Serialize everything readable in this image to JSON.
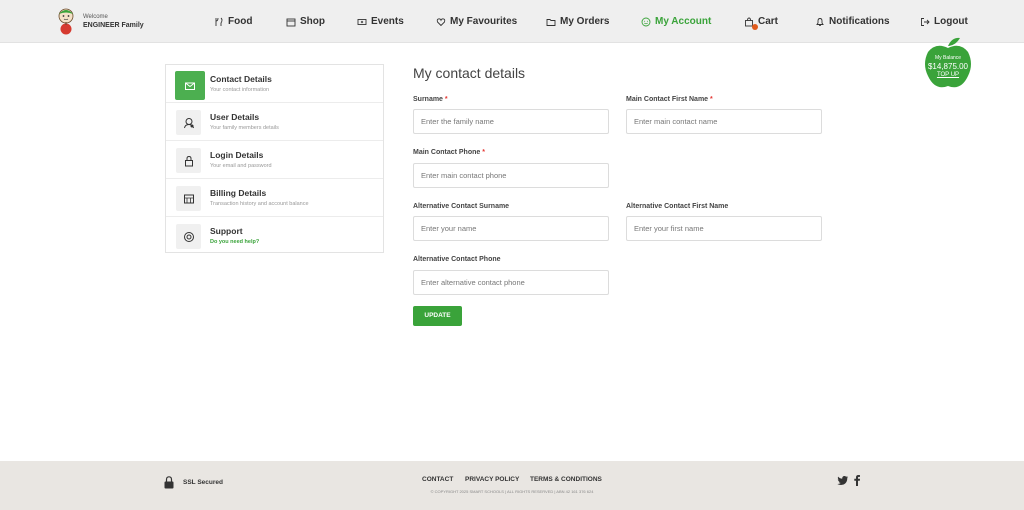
{
  "brand": {
    "welcome": "Welcome",
    "family": "ENGINEER Family"
  },
  "nav": [
    {
      "label": "Food",
      "icon": "food-icon"
    },
    {
      "label": "Shop",
      "icon": "shop-icon"
    },
    {
      "label": "Events",
      "icon": "ticket-icon"
    },
    {
      "label": "My Favourites",
      "icon": "heart-icon"
    },
    {
      "label": "My Orders",
      "icon": "folder-icon"
    },
    {
      "label": "My Account",
      "icon": "smiley-icon",
      "active": true
    },
    {
      "label": "Cart",
      "icon": "cart-bag-icon"
    },
    {
      "label": "Notifications",
      "icon": "bell-icon"
    },
    {
      "label": "Logout",
      "icon": "logout-icon"
    }
  ],
  "balance": {
    "label": "My Balance",
    "amount": "$14,875.00",
    "topup": "TOP UP"
  },
  "sidebar": [
    {
      "label": "Contact Details",
      "sub": "Your contact information",
      "icon": "mail-icon",
      "active": true
    },
    {
      "label": "User Details",
      "sub": "Your family members details",
      "icon": "users-icon"
    },
    {
      "label": "Login Details",
      "sub": "Your email and password",
      "icon": "lock-icon"
    },
    {
      "label": "Billing Details",
      "sub": "Transaction history and account balance",
      "icon": "billing-icon"
    },
    {
      "label": "Support",
      "sub": "Do you need help?",
      "icon": "lifebuoy-icon"
    }
  ],
  "form": {
    "title": "My contact details",
    "surname": {
      "label": "Surname",
      "required": "*",
      "placeholder": "Enter the family name"
    },
    "main_first": {
      "label": "Main Contact First Name",
      "required": "*",
      "placeholder": "Enter main contact name"
    },
    "main_phone": {
      "label": "Main Contact Phone",
      "required": "*",
      "placeholder": "Enter main contact phone"
    },
    "alt_surname": {
      "label": "Alternative Contact Surname",
      "placeholder": "Enter your name"
    },
    "alt_first": {
      "label": "Alternative Contact First Name",
      "placeholder": "Enter your first name"
    },
    "alt_phone": {
      "label": "Alternative Contact Phone",
      "placeholder": "Enter alternative contact phone"
    },
    "submit": "UPDATE"
  },
  "footer": {
    "ssl": "SSL Secured",
    "links": [
      "CONTACT",
      "PRIVACY POLICY",
      "TERMS & CONDITIONS"
    ],
    "copyright": "© COPYRIGHT 2025 SMART SCHOOLS | ALL RIGHTS RESERVED | ABN 42 161 376 624"
  },
  "colors": {
    "accent": "#3aa33a",
    "header_bg": "#efefef",
    "footer_bg": "#e9e6e2",
    "badge": "#e05a1b"
  }
}
